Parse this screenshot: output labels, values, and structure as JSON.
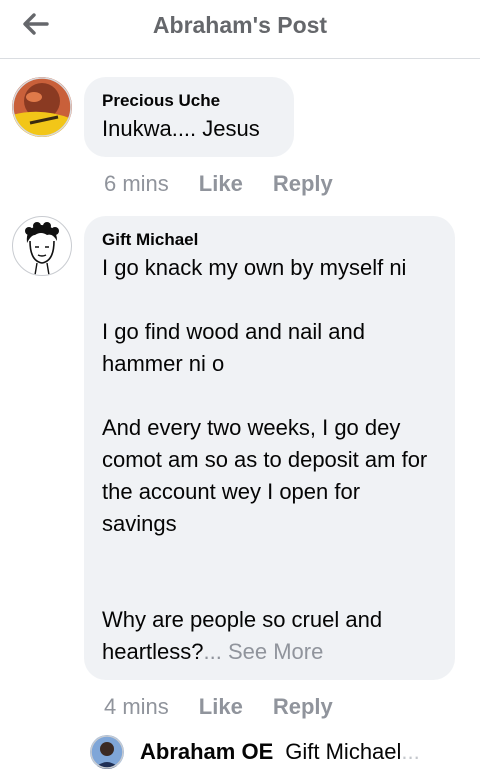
{
  "header": {
    "title": "Abraham's Post",
    "back_icon": "arrow-left-icon"
  },
  "comments": [
    {
      "author": "Precious Uche",
      "text": "Inukwa.... Jesus",
      "time": "6 mins",
      "like_label": "Like",
      "reply_label": "Reply"
    },
    {
      "author": "Gift Michael",
      "text": "I go knack my own by myself ni\n\nI go find wood and nail and hammer ni o\n\nAnd every two weeks, I go dey comot am so as to deposit am for the account wey I open for savings\n\n\nWhy are people so cruel and heartless?",
      "see_more": "... See More",
      "time": "4 mins",
      "like_label": "Like",
      "reply_label": "Reply"
    }
  ],
  "reply_preview": {
    "author": "Abraham OE",
    "text": "Gift Michael",
    "ellipsis": "..."
  },
  "colors": {
    "bubble": "#f0f2f5",
    "meta_text": "#90949c",
    "header_title": "#65676b",
    "divider": "#dadde1"
  }
}
